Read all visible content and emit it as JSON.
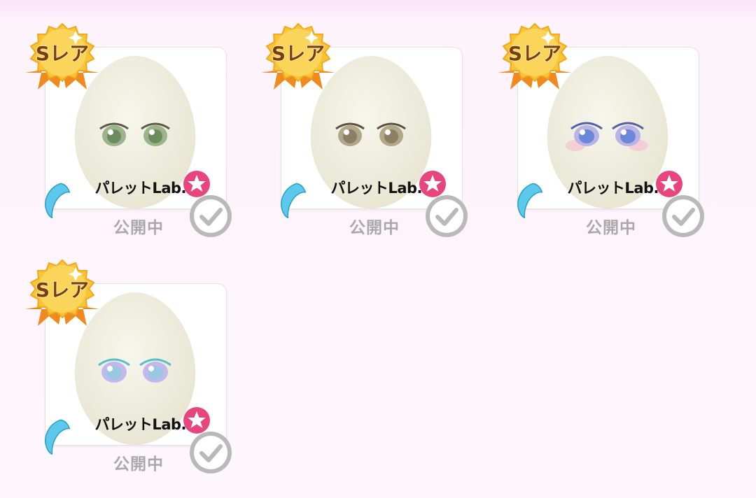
{
  "colors": {
    "background": "#fdf6fc",
    "badge_gold": "#f7c535",
    "badge_ribbon": "#f08a1e",
    "badge_text": "#7a3f0c",
    "moon": "#5bc8ec",
    "favorite_pink": "#e8457c",
    "check_gray": "#b9b9b9",
    "status_text": "#a9a9a9"
  },
  "items": [
    {
      "rarity_label": "Sレア",
      "brand": "パレットLab.",
      "status": "公開中",
      "moon_icon": "crescent-moon-icon",
      "favorite_icon": "star-icon",
      "check_icon": "checkmark-icon",
      "eye_color": "#9bb58a",
      "eye_accent": "#6e8a5f"
    },
    {
      "rarity_label": "Sレア",
      "brand": "パレットLab.",
      "status": "公開中",
      "moon_icon": "crescent-moon-icon",
      "favorite_icon": "star-icon",
      "check_icon": "checkmark-icon",
      "eye_color": "#b1a88a",
      "eye_accent": "#8d7f63"
    },
    {
      "rarity_label": "Sレア",
      "brand": "パレットLab.",
      "status": "公開中",
      "moon_icon": "crescent-moon-icon",
      "favorite_icon": "star-icon",
      "check_icon": "checkmark-icon",
      "eye_color": "#b9b3e6",
      "eye_accent": "#6c86d8"
    },
    {
      "rarity_label": "Sレア",
      "brand": "パレットLab.",
      "status": "公開中",
      "moon_icon": "crescent-moon-icon",
      "favorite_icon": "star-icon",
      "check_icon": "checkmark-icon",
      "eye_color": "#c2b8ee",
      "eye_accent": "#56c0c8"
    }
  ]
}
